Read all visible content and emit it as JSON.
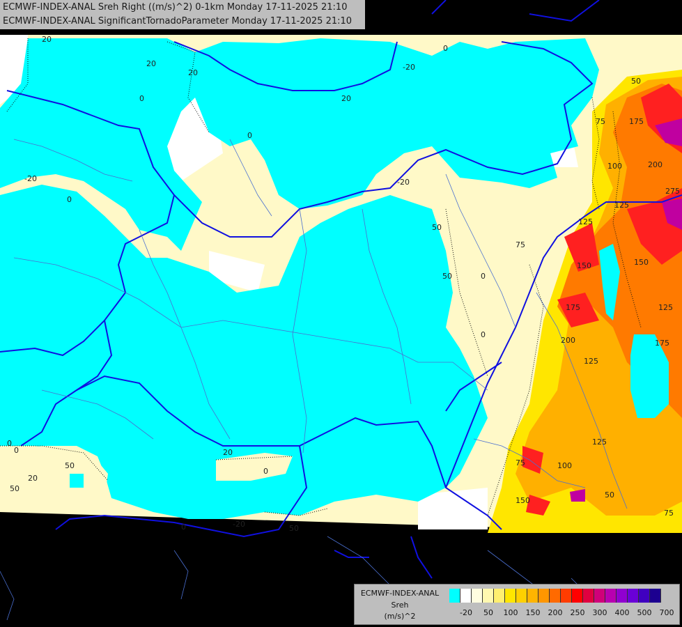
{
  "title": {
    "line1": "ECMWF-INDEX-ANAL Sreh Right ((m/s)^2) 0-1km Monday 17-11-2025 21:10",
    "line2": "ECMWF-INDEX-ANAL SignificantTornadoParameter Monday 17-11-2025 21:10"
  },
  "legend": {
    "title_line1": "ECMWF-INDEX-ANAL",
    "title_line2": "Sreh",
    "title_line3": "(m/s)^2",
    "colors": [
      "#00ffff",
      "#ffffff",
      "#fffde0",
      "#fff8b0",
      "#ffef70",
      "#ffe600",
      "#ffd000",
      "#ffb400",
      "#ff9600",
      "#ff6a00",
      "#ff3c00",
      "#ff0000",
      "#e00040",
      "#d0007a",
      "#b800b0",
      "#9000d0",
      "#6a00d8",
      "#4000c0",
      "#1c0090"
    ],
    "tick_labels": [
      "-20",
      "50",
      "100",
      "150",
      "200",
      "250",
      "300",
      "400",
      "500",
      "700"
    ]
  },
  "contour_labels": [
    "20",
    "0",
    "20",
    "0",
    "20",
    "-20",
    "0",
    "20",
    "-20",
    "0",
    "50",
    "50",
    "0",
    "-20",
    "0",
    "100",
    "175",
    "200",
    "275",
    "125",
    "125",
    "150",
    "125",
    "175",
    "200",
    "125",
    "175",
    "150",
    "125",
    "100",
    "75",
    "150",
    "50",
    "75",
    "50",
    "75",
    "0",
    "0",
    "75",
    "50",
    "20",
    "0",
    "0",
    "-20",
    "50",
    "50",
    "20"
  ],
  "colors": {
    "background": "#000000",
    "cyan_field": "#00ffff",
    "pale_field": "#fff8c0",
    "border_blue": "#0000ff",
    "river_blue": "#4a6fd0"
  }
}
